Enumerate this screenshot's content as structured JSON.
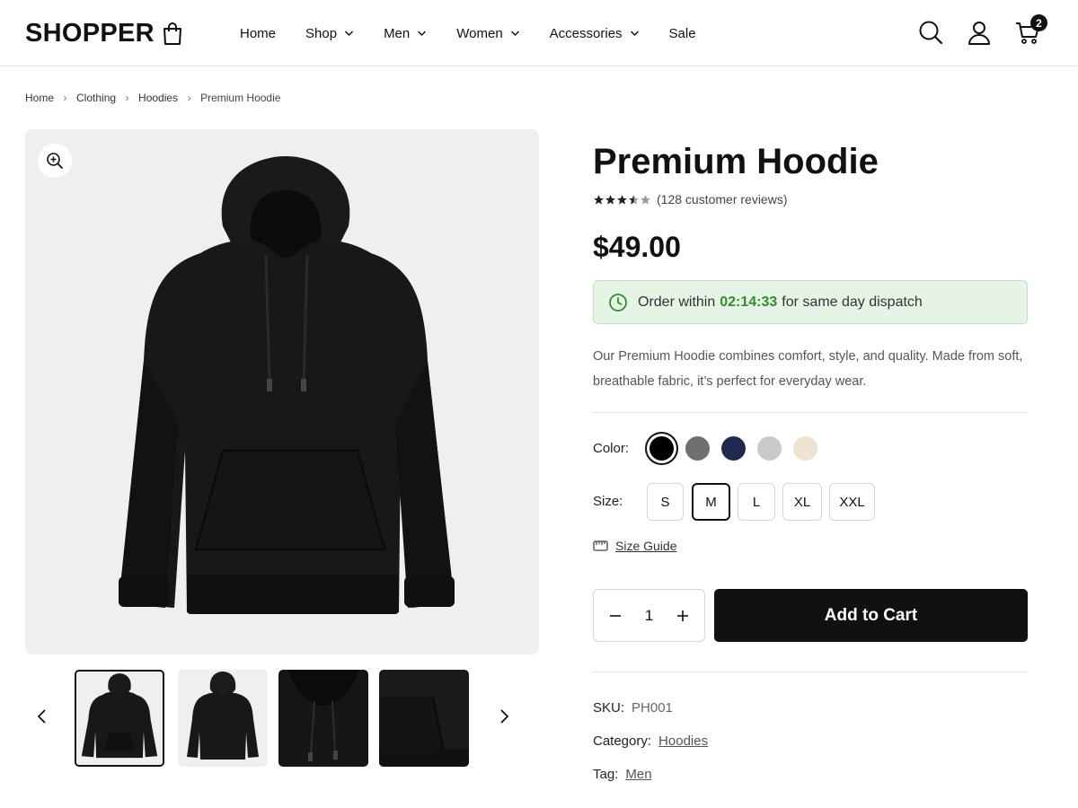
{
  "header": {
    "logo": "SHOPPER",
    "nav": [
      {
        "label": "Home",
        "dropdown": false
      },
      {
        "label": "Shop",
        "dropdown": true
      },
      {
        "label": "Men",
        "dropdown": true
      },
      {
        "label": "Women",
        "dropdown": true
      },
      {
        "label": "Accessories",
        "dropdown": true
      },
      {
        "label": "Sale",
        "dropdown": false
      }
    ],
    "icons": [
      "search-icon",
      "user-icon",
      "cart-icon"
    ],
    "cart_count": "2"
  },
  "breadcrumb": {
    "items": [
      "Home",
      "Clothing",
      "Hoodies"
    ],
    "current": "Premium Hoodie"
  },
  "gallery": {
    "thumbnail_count": 4,
    "active_thumbnail": 1
  },
  "product": {
    "title": "Premium Hoodie",
    "rating": 3.5,
    "rating_max": 5,
    "reviews": "(128 customer reviews)",
    "price": "$49.00",
    "dispatch": {
      "prefix": "Order within",
      "timer": "02:14:33",
      "suffix": "for same day dispatch"
    },
    "description": "Our Premium Hoodie combines comfort, style, and quality. Made from soft, breathable fabric, it’s perfect for everyday wear.",
    "color_label": "Color:",
    "colors": [
      "#000000",
      "#6f6f6f",
      "#1e2b4f",
      "#c9c9c9",
      "#ede3cf"
    ],
    "selected_color": "#000000",
    "size_label": "Size:",
    "sizes": [
      "S",
      "M",
      "L",
      "XL",
      "XXL"
    ],
    "selected_size": "M",
    "size_guide": "Size Guide",
    "quantity": "1",
    "add_to_cart": "Add to Cart",
    "sku_label": "SKU:",
    "sku": "PH001",
    "category_label": "Category:",
    "category": "Hoodies",
    "tag_label": "Tag:",
    "tag": "Men"
  },
  "colors": {
    "accent_green": "#2f8f2a",
    "dispatch_bg": "#e6f4e5",
    "primary": "#111111"
  }
}
